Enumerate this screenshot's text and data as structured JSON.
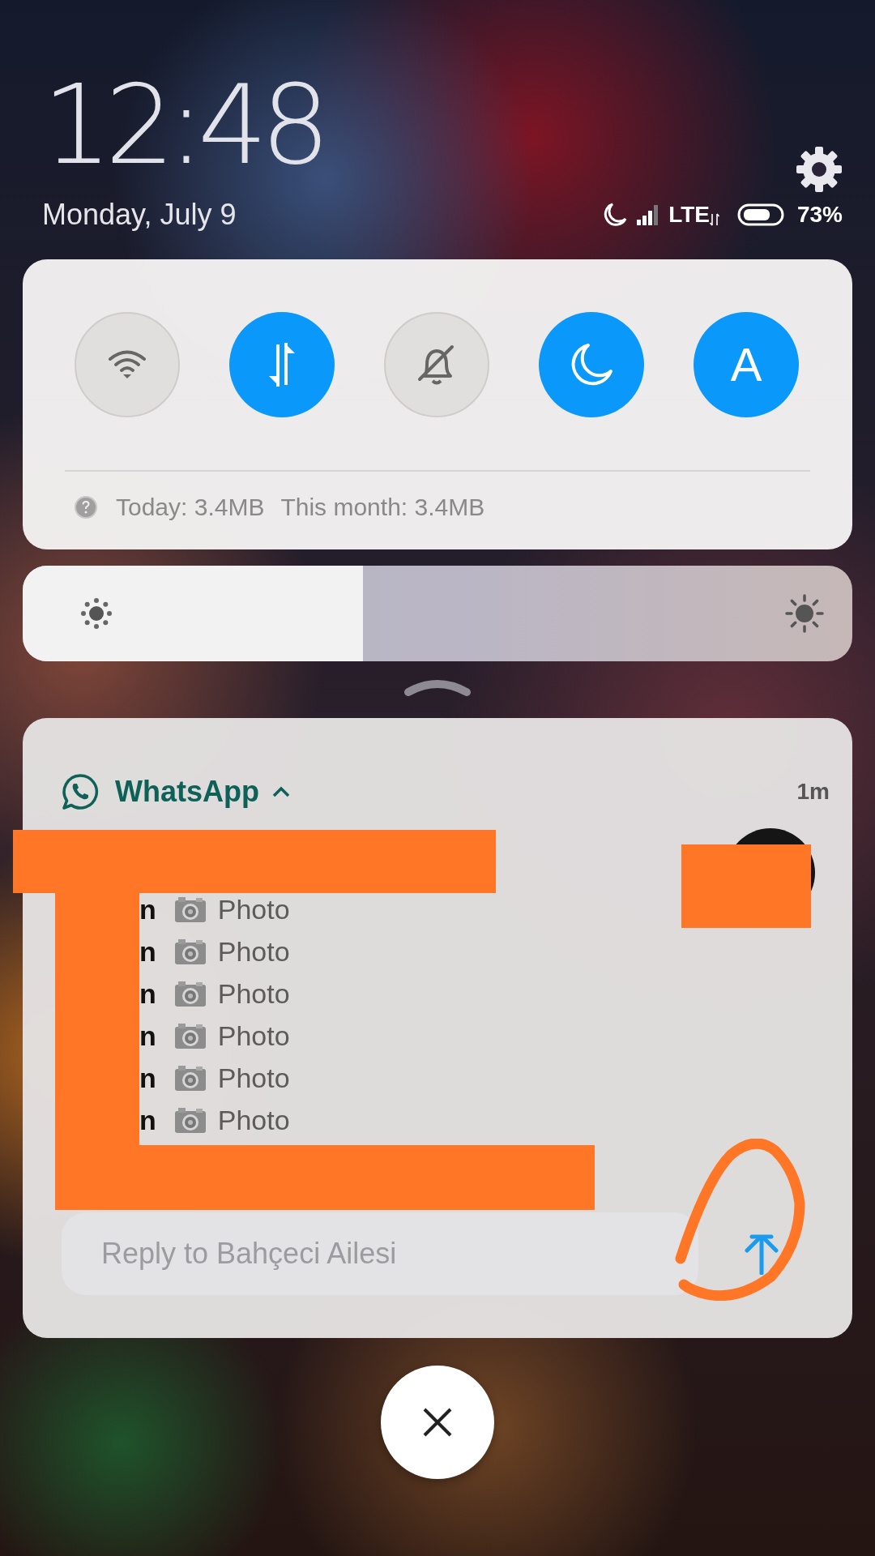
{
  "clock": {
    "time": "12:48",
    "date": "Monday, July 9"
  },
  "status_bar": {
    "network": "LTE",
    "battery_percent": "73%"
  },
  "quick_toggles": [
    {
      "kind": "wifi",
      "on": false
    },
    {
      "kind": "data",
      "on": true
    },
    {
      "kind": "silent",
      "on": false
    },
    {
      "kind": "dnd",
      "on": true
    },
    {
      "kind": "auto",
      "label": "A",
      "on": true
    }
  ],
  "data_usage": {
    "today": "Today: 3.4MB",
    "month": "This month: 3.4MB"
  },
  "brightness": {
    "level": 0.41
  },
  "notification": {
    "app": "WhatsApp",
    "expanded": true,
    "time": "1m",
    "messages": [
      {
        "sender": "n",
        "text": "Photo"
      },
      {
        "sender": "n",
        "text": "Photo"
      },
      {
        "sender": "n",
        "text": "Photo"
      },
      {
        "sender": "n",
        "text": "Photo"
      },
      {
        "sender": "n",
        "text": "Photo"
      },
      {
        "sender": "n",
        "text": "Photo"
      }
    ],
    "reply": {
      "placeholder": "Reply to Bahçeci Ailesi"
    }
  }
}
